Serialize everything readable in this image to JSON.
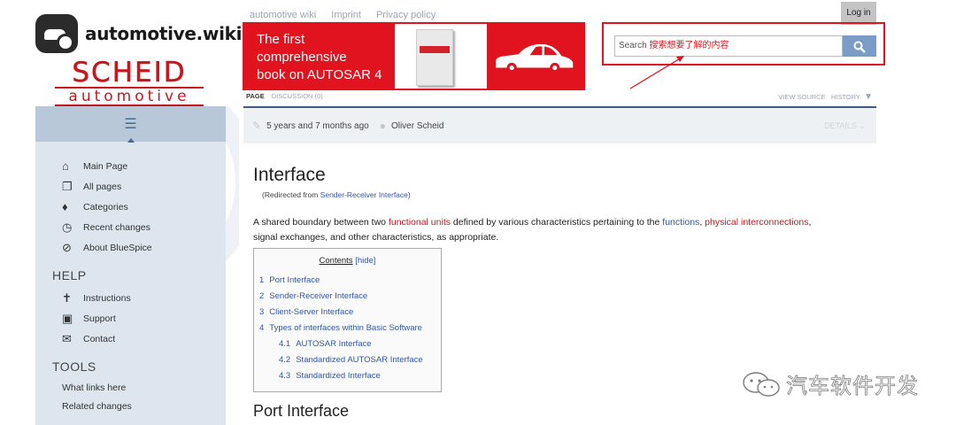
{
  "logo": {
    "wiki_text": "automotive.wiki",
    "brand_big": "SCHEID",
    "brand_small": "automotive"
  },
  "sidebar": {
    "nav": [
      {
        "label": "Main Page",
        "icon": "home-icon"
      },
      {
        "label": "All pages",
        "icon": "pages-icon"
      },
      {
        "label": "Categories",
        "icon": "tag-icon"
      },
      {
        "label": "Recent changes",
        "icon": "clock-icon"
      },
      {
        "label": "About BlueSpice",
        "icon": "compass-icon"
      }
    ],
    "help_title": "HELP",
    "help": [
      {
        "label": "Instructions",
        "icon": "signpost-icon"
      },
      {
        "label": "Support",
        "icon": "chat-icon"
      },
      {
        "label": "Contact",
        "icon": "envelope-icon"
      }
    ],
    "tools_title": "TOOLS",
    "tools": [
      "What links here",
      "Related changes"
    ]
  },
  "topnav": {
    "site": "automotive wiki",
    "imprint": "Imprint",
    "privacy": "Privacy policy",
    "login": "Log in"
  },
  "banner": {
    "line1": "The first",
    "line2": "comprehensive",
    "line3": "book on AUTOSAR 4"
  },
  "search": {
    "placeholder": "Search",
    "annotation": "搜索想要了解的内容"
  },
  "tabs": {
    "page": "PAGE",
    "discussion": "DISCUSSION (0)",
    "view_source": "VIEW SOURCE",
    "history": "HISTORY"
  },
  "meta": {
    "time": "5 years and 7 months ago",
    "author": "Oliver Scheid",
    "details": "DETAILS"
  },
  "article": {
    "title": "Interface",
    "redirect_prefix": "(Redirected from ",
    "redirect_link": "Sender-Receiver Interface",
    "redirect_suffix": ")",
    "p1": "A shared boundary between two ",
    "link1": "functional units",
    "p2": " defined by various characteristics pertaining to the ",
    "link2": "functions",
    "p3": ", ",
    "link3": "physical interconnections",
    "p4": ",",
    "p5": "signal exchanges, and other characteristics, as appropriate.",
    "toc_title": "Contents",
    "toc_hide": "[hide]",
    "toc": [
      {
        "num": "1",
        "label": "Port Interface"
      },
      {
        "num": "2",
        "label": "Sender-Receiver Interface"
      },
      {
        "num": "3",
        "label": "Client-Server Interface"
      },
      {
        "num": "4",
        "label": "Types of interfaces within Basic Software"
      },
      {
        "num": "4.1",
        "label": "AUTOSAR Interface"
      },
      {
        "num": "4.2",
        "label": "Standardized AUTOSAR Interface"
      },
      {
        "num": "4.3",
        "label": "Standardized Interface"
      }
    ],
    "section_title": "Port Interface"
  },
  "watermark": {
    "text": "汽车软件开发"
  },
  "colors": {
    "accent": "#e0131e",
    "link": "#3456a0",
    "sidebar_bg": "#dde6ef",
    "tabline": "#3f5a86"
  }
}
